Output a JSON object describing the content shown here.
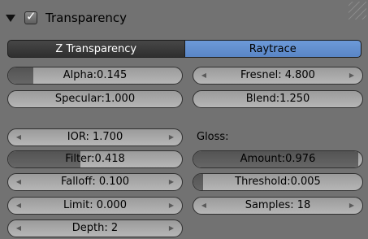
{
  "panel": {
    "title": "Transparency",
    "enabled_check": "✓"
  },
  "tabs": [
    {
      "label": "Z Transparency",
      "active": false
    },
    {
      "label": "Raytrace",
      "active": true
    }
  ],
  "left": {
    "alpha": {
      "label": "Alpha:0.145",
      "fraction": 0.145
    },
    "specular": {
      "label": "Specular:1.000"
    },
    "ior": {
      "label": "IOR: 1.700"
    },
    "filter": {
      "label": "Filter:0.418",
      "fraction": 0.418
    },
    "falloff": {
      "label": "Falloff: 0.100"
    },
    "limit": {
      "label": "Limit: 0.000"
    },
    "depth": {
      "label": "Depth: 2"
    }
  },
  "right": {
    "fresnel": {
      "label": "Fresnel: 4.800"
    },
    "blend": {
      "label": "Blend:1.250"
    },
    "gloss_heading": "Gloss:",
    "amount": {
      "label": "Amount:0.976",
      "fraction": 0.976
    },
    "threshold": {
      "label": "Threshold:0.005",
      "fraction": 0.005
    },
    "samples": {
      "label": "Samples: 18"
    }
  },
  "icons": {
    "arrow_left": "◀",
    "arrow_right": "▶"
  },
  "colors": {
    "panel_bg": "#727272",
    "active_tab": "#6c9ad8",
    "inactive_tab": "#3a3a3a",
    "slider_fill": "#5a5a5a"
  }
}
